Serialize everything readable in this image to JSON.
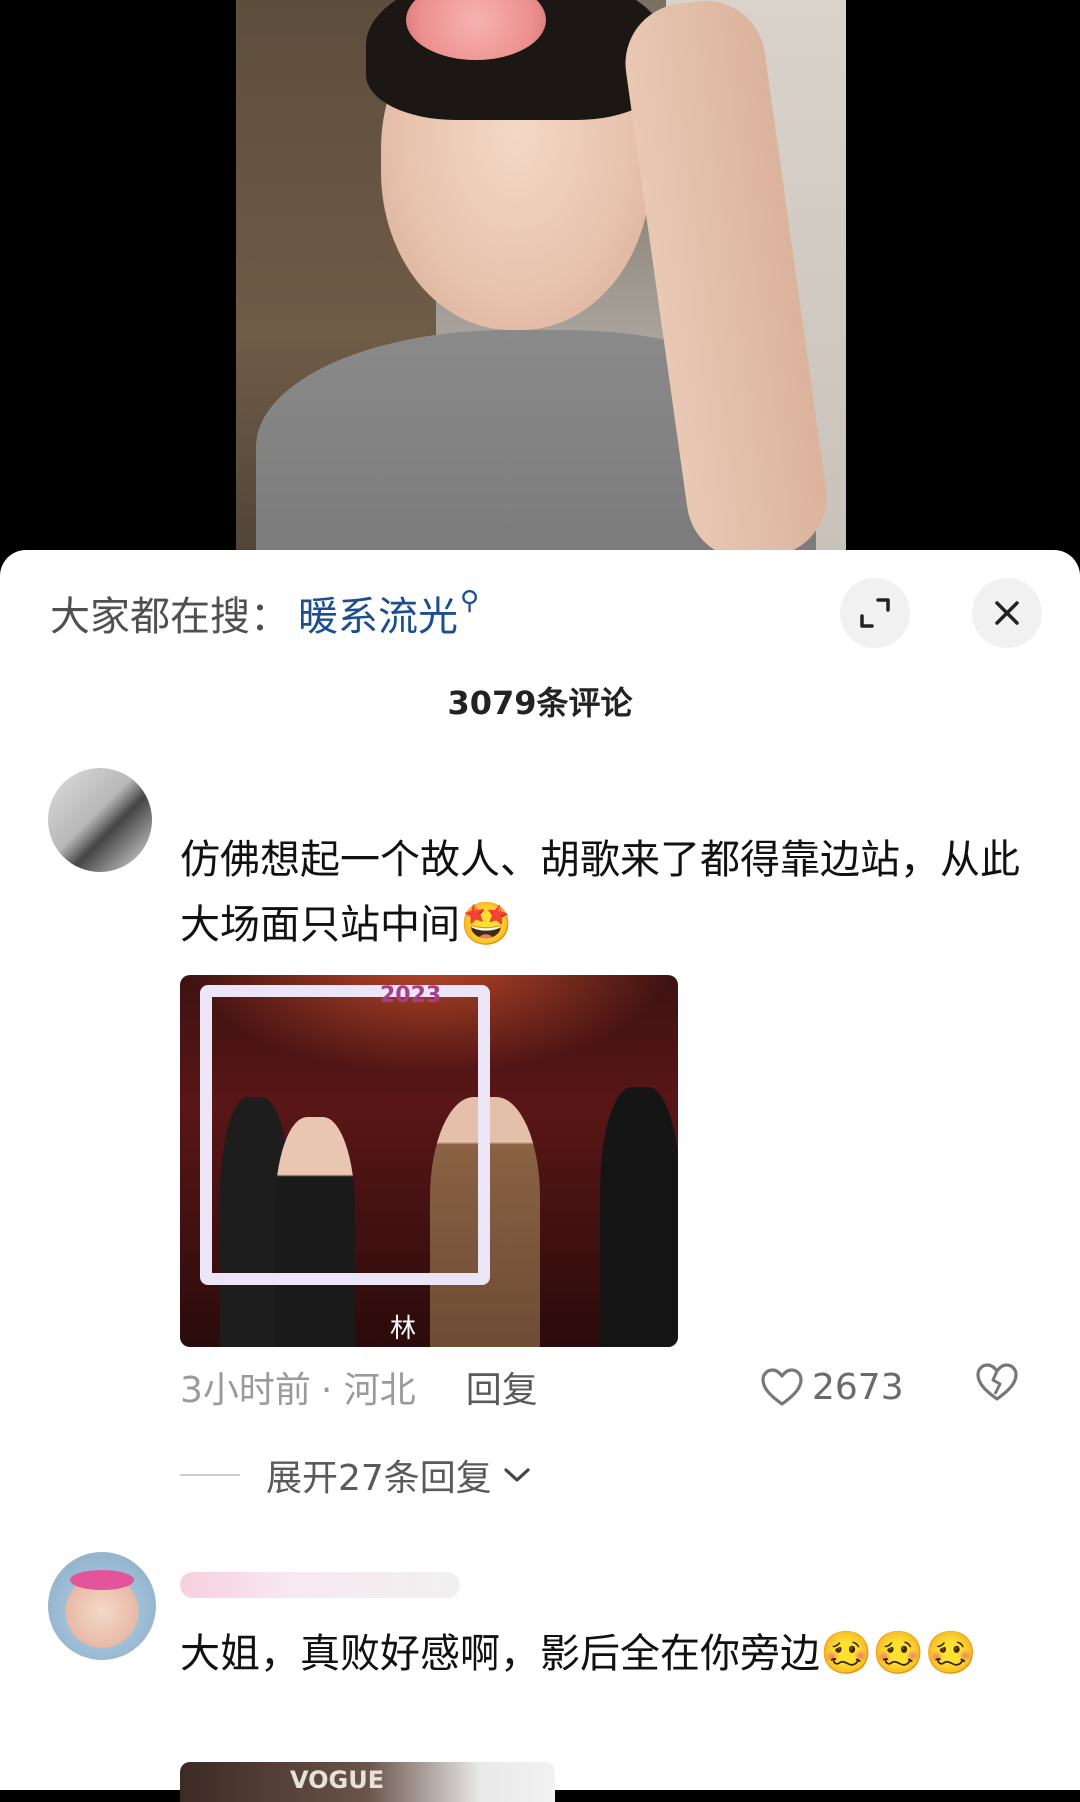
{
  "search": {
    "prefix": "大家都在搜：",
    "term": "暖系流光",
    "search_icon": "search-icon"
  },
  "header": {
    "comment_count": "3079条评论",
    "expand_icon": "expand-icon",
    "close_icon": "close-icon"
  },
  "comments": [
    {
      "text": "仿佛想起一个故人、胡歌来了都得靠边站，从此大场面只站中间",
      "emoji": "🤩",
      "image": {
        "badge": "2023",
        "label": "林"
      },
      "time": "3小时前",
      "location": "· 河北",
      "reply_label": "回复",
      "likes": "2673",
      "heart_icon": "heart-icon",
      "dislike_icon": "broken-heart-icon",
      "expand_replies_label": "展开27条回复"
    },
    {
      "text": "大姐，真败好感啊，影后全在你旁边",
      "emoji_sequence": "🥴🥴🥴"
    }
  ],
  "next_image": {
    "label": "VOGUE"
  },
  "colors": {
    "accent_link": "#1d4e8f",
    "sheet_bg": "#ffffff",
    "meta_text": "#9a9a9a"
  }
}
